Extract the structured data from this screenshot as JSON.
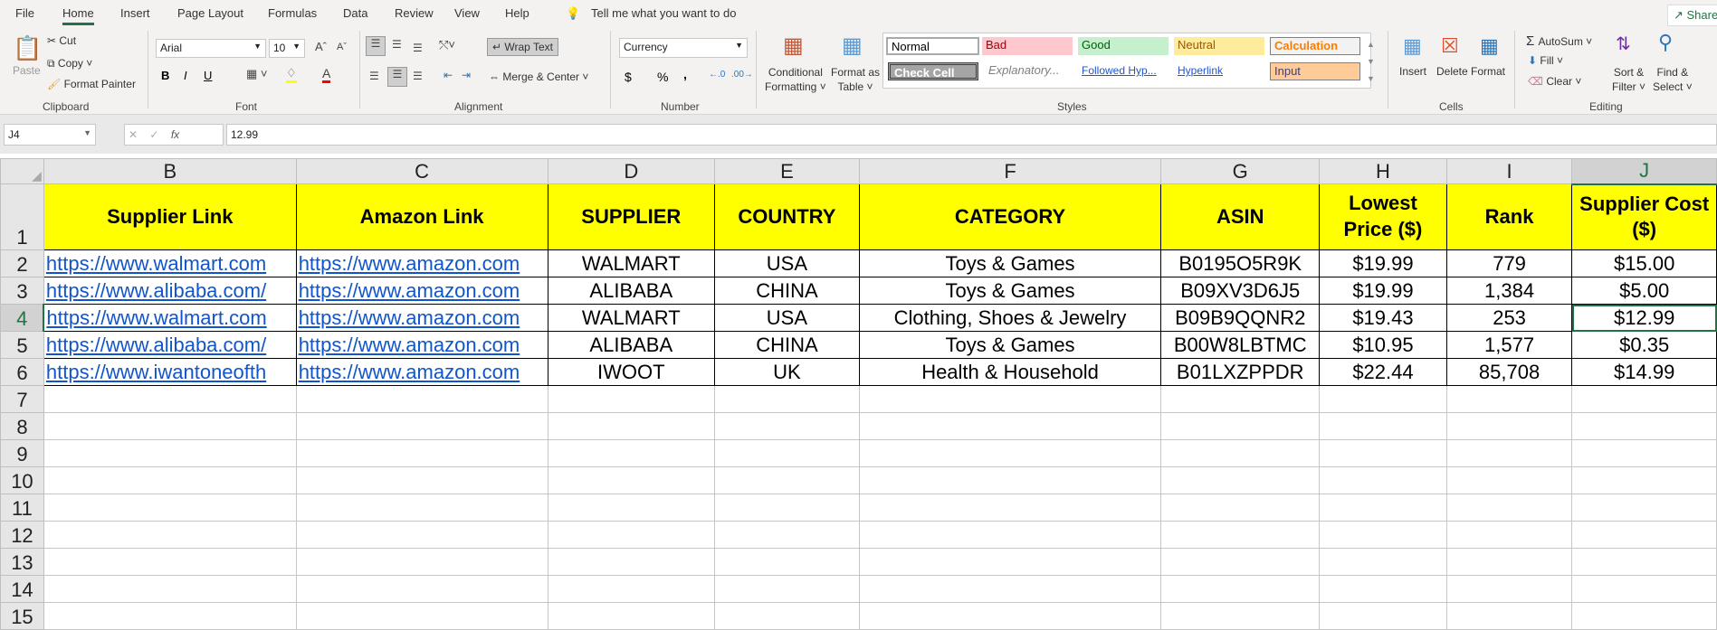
{
  "tabs": [
    "File",
    "Home",
    "Insert",
    "Page Layout",
    "Formulas",
    "Data",
    "Review",
    "View",
    "Help"
  ],
  "tell_me": "Tell me what you want to do",
  "share": "Share",
  "clipboard": {
    "paste": "Paste",
    "cut": "Cut",
    "copy": "Copy",
    "format_painter": "Format Painter",
    "label": "Clipboard"
  },
  "font": {
    "name": "Arial",
    "size": "10",
    "bold": "B",
    "italic": "I",
    "underline": "U",
    "label": "Font"
  },
  "alignment": {
    "wrap": "Wrap Text",
    "merge": "Merge & Center",
    "label": "Alignment"
  },
  "number": {
    "format": "Currency",
    "dollar": "$",
    "percent": "%",
    "comma": ",",
    "label": "Number"
  },
  "styles": {
    "cond1": "Conditional",
    "cond2": "Formatting",
    "fmt1": "Format as",
    "fmt2": "Table",
    "items": [
      "Normal",
      "Bad",
      "Good",
      "Neutral",
      "Calculation",
      "Check Cell",
      "Explanatory...",
      "Followed Hyp...",
      "Hyperlink",
      "Input"
    ],
    "label": "Styles"
  },
  "cells": {
    "insert": "Insert",
    "delete": "Delete",
    "format": "Format",
    "label": "Cells"
  },
  "editing": {
    "autosum": "AutoSum",
    "fill": "Fill",
    "clear": "Clear",
    "sort1": "Sort &",
    "sort2": "Filter",
    "find1": "Find &",
    "find2": "Select",
    "label": "Editing"
  },
  "formula_bar": {
    "name_box": "J4",
    "fx": "fx",
    "value": "12.99"
  },
  "columns": [
    "B",
    "C",
    "D",
    "E",
    "F",
    "G",
    "H",
    "I",
    "J"
  ],
  "selected": {
    "col": "J",
    "row": 4
  },
  "header": [
    "Supplier Link",
    "Amazon Link",
    "SUPPLIER",
    "COUNTRY",
    "CATEGORY",
    "ASIN",
    "Lowest Price ($)",
    "Rank",
    "Supplier Cost ($)"
  ],
  "rows": [
    [
      "https://www.walmart.com",
      "https://www.amazon.com",
      "WALMART",
      "USA",
      "Toys & Games",
      "B0195O5R9K",
      "$19.99",
      "779",
      "$15.00"
    ],
    [
      "https://www.alibaba.com/",
      "https://www.amazon.com",
      "ALIBABA",
      "CHINA",
      "Toys & Games",
      "B09XV3D6J5",
      "$19.99",
      "1,384",
      "$5.00"
    ],
    [
      "https://www.walmart.com",
      "https://www.amazon.com",
      "WALMART",
      "USA",
      "Clothing, Shoes & Jewelry",
      "B09B9QQNR2",
      "$19.43",
      "253",
      "$12.99"
    ],
    [
      "https://www.alibaba.com/",
      "https://www.amazon.com",
      "ALIBABA",
      "CHINA",
      "Toys & Games",
      "B00W8LBTMC",
      "$10.95",
      "1,577",
      "$0.35"
    ],
    [
      "https://www.iwantoneofth",
      "https://www.amazon.com",
      "IWOOT",
      "UK",
      "Health & Household",
      "B01LXZPPDR",
      "$22.44",
      "85,708",
      "$14.99"
    ]
  ],
  "row_numbers": [
    "1",
    "2",
    "3",
    "4",
    "5",
    "6",
    "7",
    "8",
    "9",
    "10",
    "11",
    "12",
    "13",
    "14",
    "15"
  ]
}
